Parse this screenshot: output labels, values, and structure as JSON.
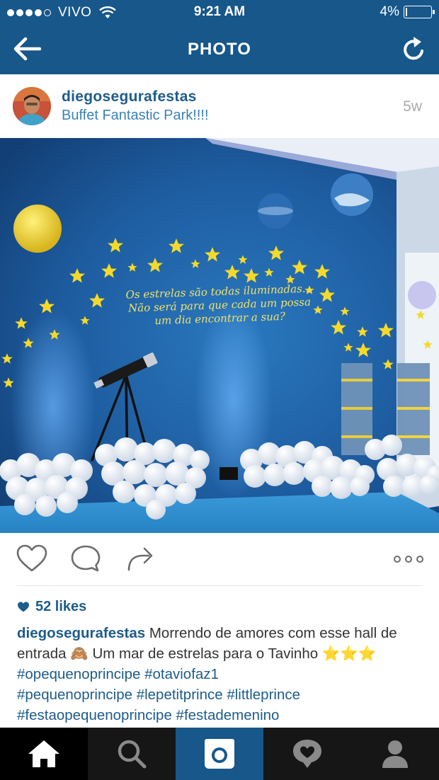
{
  "status_bar": {
    "carrier": "VIVO",
    "time": "9:21 AM",
    "battery_text": "4%",
    "battery_level": 0.04
  },
  "nav": {
    "title": "PHOTO",
    "back_icon": "arrow-left-icon",
    "refresh_icon": "refresh-icon"
  },
  "post": {
    "username": "diegosegurafestas",
    "location": "Buffet Fantastic Park!!!!",
    "age": "5w"
  },
  "photo": {
    "quote_lines": [
      "Os estrelas são todas iluminadas...",
      "Não será para que cada um possa",
      "um dia encontrar a sua?"
    ]
  },
  "actions": {
    "like_icon": "heart-icon",
    "comment_icon": "comment-icon",
    "share_icon": "share-icon",
    "more_icon": "more-options-icon"
  },
  "likes": {
    "text": "52 likes"
  },
  "caption": {
    "username": "diegosegurafestas",
    "text_1": " Morrendo de amores com esse hall de entrada ",
    "emoji_1": "🙈",
    "text_2": " Um mar de estrelas para o Tavinho ",
    "emoji_stars": "⭐⭐⭐",
    "tags_1": " #opequenoprincipe #otaviofaz1",
    "tags_2": "#pequenoprincipe #lepetitprince #littleprince",
    "tags_3": "#festaopequenoprincipe #festademenino"
  },
  "tabbar": {
    "tabs": [
      "home-icon",
      "search-icon",
      "camera-icon",
      "activity-icon",
      "profile-icon"
    ]
  },
  "colors": {
    "brand_blue": "#17578a",
    "link_blue": "#1e5c8a",
    "tabbar_bg": "#161616"
  }
}
